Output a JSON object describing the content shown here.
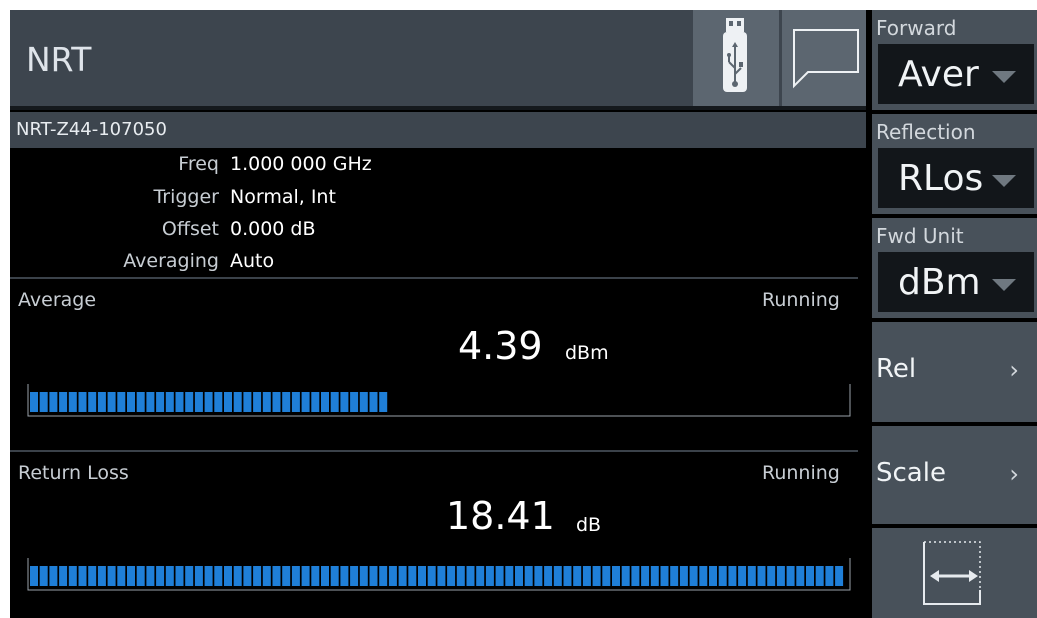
{
  "header": {
    "title": "NRT"
  },
  "sensor": {
    "name": "NRT-Z44-107050",
    "rows": [
      {
        "label": "Freq",
        "value": "1.000 000 GHz"
      },
      {
        "label": "Trigger",
        "value": "Normal, Int"
      },
      {
        "label": "Offset",
        "value": "0.000 dB"
      },
      {
        "label": "Averaging",
        "value": "Auto"
      }
    ]
  },
  "average": {
    "label": "Average",
    "status": "Running",
    "value": "4.39",
    "unit": "dBm",
    "scale": [
      "0",
      "1",
      "2",
      "3",
      "4",
      "5",
      "6",
      "7",
      "8",
      "9",
      "10"
    ],
    "bar_value": 4.39,
    "bar_min": 0,
    "bar_max": 10
  },
  "return_loss": {
    "label": "Return Loss",
    "status": "Running",
    "value": "18.41",
    "unit": "dB",
    "scale": [
      "5",
      "6",
      "7",
      "8",
      "9",
      "10",
      "11",
      "12",
      "13",
      "14",
      "15"
    ],
    "bar_value": 15,
    "bar_min": 5,
    "bar_max": 15
  },
  "sidebar": {
    "forward": {
      "label": "Forward",
      "value": "Aver"
    },
    "reflection": {
      "label": "Reflection",
      "value": "RLos"
    },
    "fwd_unit": {
      "label": "Fwd Unit",
      "value": "dBm"
    },
    "rel": {
      "label": "Rel"
    },
    "scale": {
      "label": "Scale"
    }
  },
  "colors": {
    "bar": "#1f7fd8",
    "panel": "#3d454e"
  },
  "icons": [
    "usb-icon",
    "message-icon",
    "chevron-right-icon",
    "autoscale-icon"
  ]
}
